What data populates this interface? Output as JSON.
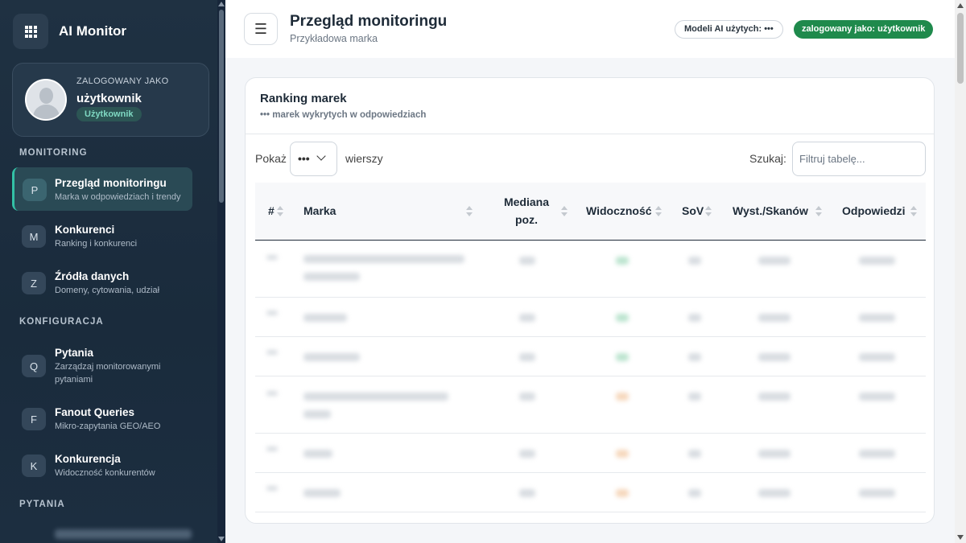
{
  "app": {
    "brand_name": "AI Monitor",
    "brand_icon": "grid-icon"
  },
  "user_card": {
    "label": "ZALOGOWANY JAKO",
    "name": "użytkownik",
    "role": "Użytkownik"
  },
  "sidebar": {
    "section_monitoring": "MONITORING",
    "section_config": "KONFIGURACJA",
    "section_questions": "PYTANIA",
    "items": [
      {
        "badge": "P",
        "title": "Przegląd monitoringu",
        "sub": "Marka w odpowiedziach i trendy",
        "active": true
      },
      {
        "badge": "M",
        "title": "Konkurenci",
        "sub": "Ranking i konkurenci",
        "active": false
      },
      {
        "badge": "Z",
        "title": "Źródła danych",
        "sub": "Domeny, cytowania, udział",
        "active": false
      },
      {
        "badge": "Q",
        "title": "Pytania",
        "sub": "Zarządzaj monitorowanymi pytaniami",
        "active": false
      },
      {
        "badge": "F",
        "title": "Fanout Queries",
        "sub": "Mikro-zapytania GEO/AEO",
        "active": false
      },
      {
        "badge": "K",
        "title": "Konkurencja",
        "sub": "Widoczność konkurentów",
        "active": false
      }
    ]
  },
  "header": {
    "menu_icon": "☰",
    "title": "Przegląd monitoringu",
    "subtitle": "Przykładowa marka",
    "models_pill": "Modeli AI użytych: •••",
    "user_pill": "zalogowany jako: użytkownik"
  },
  "card": {
    "title": "Ranking marek",
    "subtitle": "••• marek wykrytych w odpowiedziach",
    "show_label": "Pokaż",
    "show_value": "•••",
    "rows_label": "wierszy",
    "search_label": "Szukaj:",
    "search_placeholder": "Filtruj tabelę..."
  },
  "table": {
    "columns": [
      "#",
      "Marka",
      "Mediana poz.",
      "Widoczność",
      "SoV",
      "Wyst./Skanów",
      "Odpowiedzi"
    ],
    "col_median_line1": "Mediana",
    "col_median_line2": "poz."
  },
  "colors": {
    "sidebar_bg": "#1f3142",
    "accent": "#33c2a6",
    "user_pill": "#1f8a4c"
  }
}
